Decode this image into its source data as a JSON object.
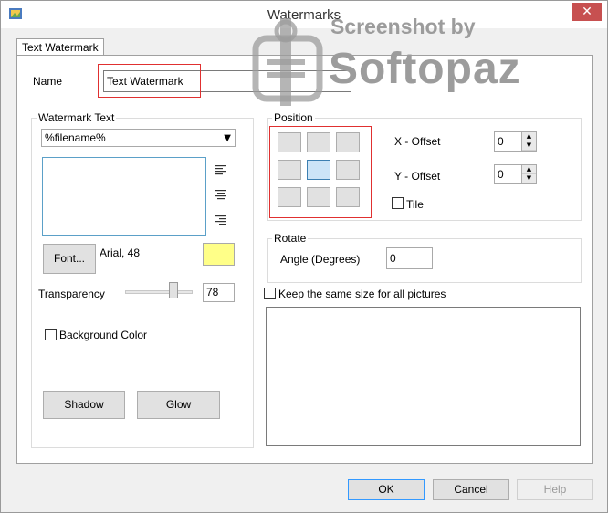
{
  "window": {
    "title": "Watermarks",
    "close_glyph": "✕"
  },
  "tab": {
    "label": "Text Watermark"
  },
  "name_field": {
    "label": "Name",
    "value": "Text Watermark"
  },
  "watermark_text": {
    "group_label": "Watermark Text",
    "combo_value": "%filename%",
    "text_value": "",
    "align_icons": [
      "align-left-icon",
      "align-center-icon",
      "align-right-icon"
    ]
  },
  "font": {
    "button_label": "Font...",
    "font_value": "Arial, 48",
    "color": "#ffff88"
  },
  "transparency": {
    "label": "Transparency",
    "value": "78"
  },
  "background_color": {
    "label": "Background Color"
  },
  "effects": {
    "shadow_label": "Shadow",
    "glow_label": "Glow"
  },
  "position": {
    "group_label": "Position",
    "selected_cell": 4,
    "x_offset_label": "X - Offset",
    "x_offset_value": "0",
    "y_offset_label": "Y - Offset",
    "y_offset_value": "0",
    "tile_label": "Tile"
  },
  "rotate": {
    "group_label": "Rotate",
    "angle_label": "Angle (Degrees)",
    "angle_value": "0"
  },
  "keep_size": {
    "label": "Keep the same size for all pictures"
  },
  "footer": {
    "ok_label": "OK",
    "cancel_label": "Cancel",
    "help_label": "Help"
  },
  "overlay": {
    "line1": "Screenshot by",
    "line2": "Softopaz"
  }
}
